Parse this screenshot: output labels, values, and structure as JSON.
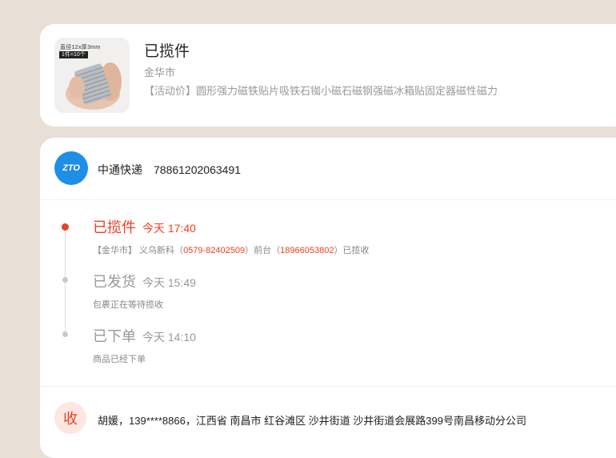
{
  "order": {
    "image_caption_size": "直径12x厚3mm",
    "image_caption_pack": "1件=10个",
    "status": "已揽件",
    "city": "金华市",
    "product_title": "【活动价】圆形强力磁铁贴片吸铁石铷小磁石磁钢强磁冰箱贴固定器磁性磁力"
  },
  "courier": {
    "logo_text": "ZTO",
    "name": "中通快递",
    "tracking_number": "78861202063491"
  },
  "timeline": [
    {
      "status": "已揽件",
      "time": "今天 17:40",
      "detail_prefix": "【金华市】 义乌新科（",
      "phone1": "0579-82402509",
      "detail_mid": "）前台（",
      "phone2": "18966053802",
      "detail_suffix": "）已揽收",
      "active": true
    },
    {
      "status": "已发货",
      "time": "今天 15:49",
      "detail": "包裹正在等待揽收",
      "active": false
    },
    {
      "status": "已下单",
      "time": "今天 14:10",
      "detail": "商品已经下单",
      "active": false
    }
  ],
  "receiver": {
    "badge": "收",
    "info": "胡媛，139****8866，江西省 南昌市 红谷滩区 沙井街道 沙井街道会展路399号南昌移动分公司"
  },
  "colors": {
    "accent": "#ee3f22",
    "courier_blue": "#1f8ee6",
    "page_bg": "#e8dfd7"
  }
}
